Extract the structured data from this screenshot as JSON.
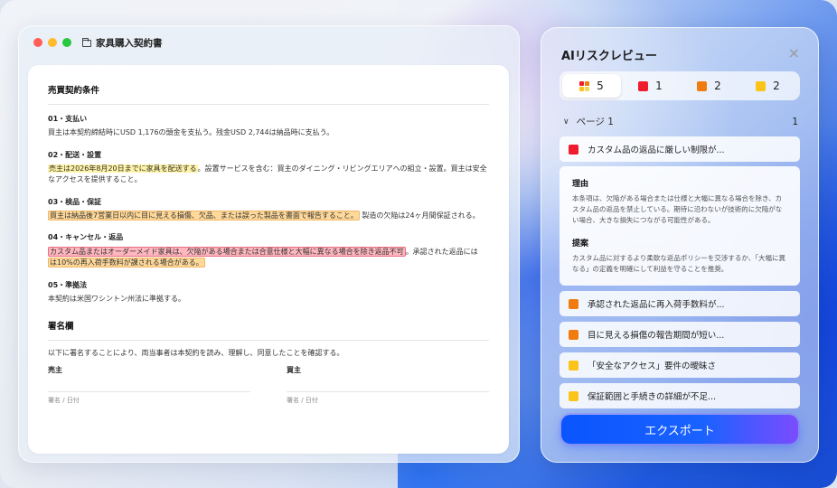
{
  "colors": {
    "red": "#ee1c2c",
    "orange": "#f07b0f",
    "yellow": "#fcc419",
    "accent": "#1a5cff"
  },
  "window": {
    "title": "家具購入契約書"
  },
  "document": {
    "section_title": "売買契約条件",
    "clauses": [
      {
        "heading": "01・支払い",
        "body": "買主は本契約締結時にUSD 1,176の頭金を支払う。残金USD 2,744は納品時に支払う。"
      },
      {
        "heading": "02・配送・設置",
        "hl": "売主は2026年8月20日までに家具を配送する",
        "body": "。設置サービスを含む：買主のダイニング・リビングエリアへの組立・設置。買主は安全なアクセスを提供すること。"
      },
      {
        "heading": "03・検品・保証",
        "hl": "買主は納品後7営業日以内に目に見える損傷、欠品、または誤った製品を書面で報告すること。",
        "body": " 製造の欠陥は24ヶ月間保証される。"
      },
      {
        "heading": "04・キャンセル・返品",
        "hl_red": "カスタム品またはオーダーメイド家具は、欠陥がある場合または合意仕様と大幅に異なる場合を除き返品不可",
        "body": "。承認された返品には",
        "hl_orange": "は10%の再入荷手数料が課される場合がある。"
      },
      {
        "heading": "05・準拠法",
        "body": "本契約は米国ワシントン州法に準拠する。"
      }
    ],
    "signature": {
      "title": "署名欄",
      "statement": "以下に署名することにより、両当事者は本契約を読み、理解し、同意したことを確認する。",
      "seller": "売主",
      "buyer": "買主",
      "caption": "署名 / 日付"
    }
  },
  "ai_panel": {
    "title": "AIリスクレビュー",
    "close": "×",
    "filters": [
      {
        "icon": "all-issues-icon",
        "count": "5"
      },
      {
        "icon": "red-square",
        "count": "1"
      },
      {
        "icon": "orange-square",
        "count": "2"
      },
      {
        "icon": "yellow-square",
        "count": "2"
      }
    ],
    "page_label": "ページ 1",
    "page_count": "1",
    "issues": [
      {
        "severity": "red",
        "title": "カスタム品の返品に厳しい制限が..."
      },
      {
        "severity": "orange",
        "title": "承認された返品に再入荷手数料が..."
      },
      {
        "severity": "orange",
        "title": "目に見える損傷の報告期間が短い..."
      },
      {
        "severity": "yellow",
        "title": "「安全なアクセス」要件の曖昧さ"
      },
      {
        "severity": "yellow",
        "title": "保証範囲と手続きの詳細が不足..."
      }
    ],
    "detail": {
      "reason_h": "理由",
      "reason": "本条項は、欠陥がある場合または仕様と大幅に異なる場合を除き、カスタム品の返品を禁止している。期待に沿わないが技術的に欠陥がない場合、大きな損失につながる可能性がある。",
      "suggest_h": "提案",
      "suggest": "カスタム品に対するより柔軟な返品ポリシーを交渉するか、「大幅に異なる」の定義を明確にして利益を守ることを推奨。"
    },
    "export_label": "エクスポート"
  }
}
